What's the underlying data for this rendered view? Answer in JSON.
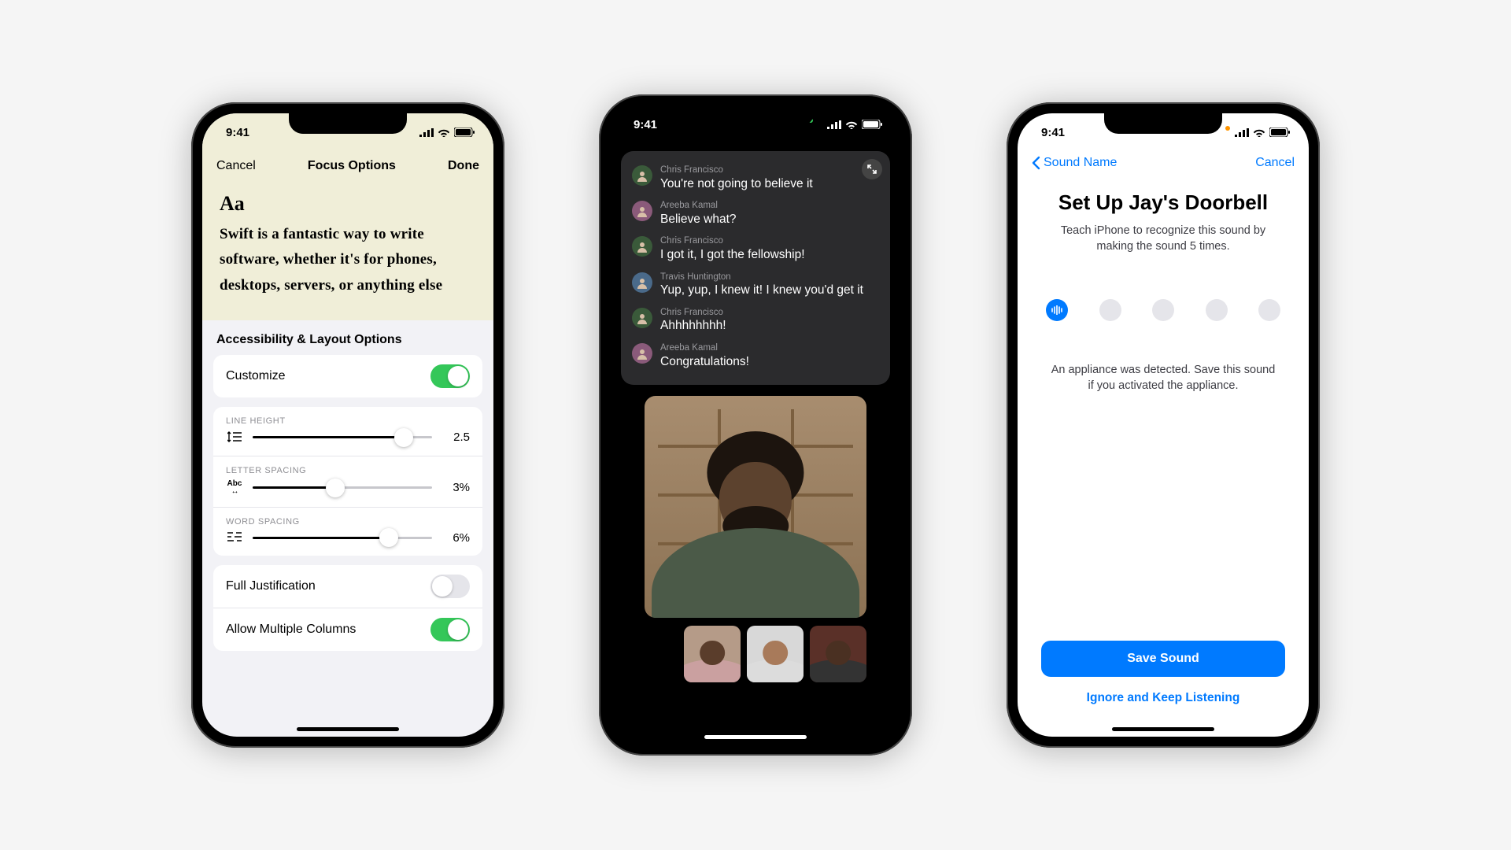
{
  "status": {
    "time": "9:41"
  },
  "phone1": {
    "nav": {
      "cancel": "Cancel",
      "title": "Focus Options",
      "done": "Done"
    },
    "reader": {
      "aa": "Aa",
      "passage": "Swift is a fantastic way to write software, whether it's for phones, desktops, servers, or anything else"
    },
    "section_title": "Accessibility & Layout Options",
    "customize_label": "Customize",
    "customize_on": true,
    "sliders": {
      "line_height": {
        "heading": "LINE HEIGHT",
        "value": "2.5",
        "pct": 84
      },
      "letter_spacing": {
        "heading": "LETTER SPACING",
        "value": "3%",
        "pct": 46
      },
      "word_spacing": {
        "heading": "WORD SPACING",
        "value": "6%",
        "pct": 76
      }
    },
    "full_justification_label": "Full Justification",
    "full_justification_on": false,
    "multi_columns_label": "Allow Multiple Columns",
    "multi_columns_on": true
  },
  "phone2": {
    "captions": [
      {
        "name": "Chris Francisco",
        "line": "You're not going to believe it",
        "avatar_bg": "#3a5a3a"
      },
      {
        "name": "Areeba Kamal",
        "line": "Believe what?",
        "avatar_bg": "#8a5a7a"
      },
      {
        "name": "Chris Francisco",
        "line": "I got it, I got the fellowship!",
        "avatar_bg": "#3a5a3a"
      },
      {
        "name": "Travis Huntington",
        "line": "Yup, yup, I knew it! I knew you'd get it",
        "avatar_bg": "#4a6a8a"
      },
      {
        "name": "Chris Francisco",
        "line": "Ahhhhhhhh!",
        "avatar_bg": "#3a5a3a"
      },
      {
        "name": "Areeba Kamal",
        "line": "Congratulations!",
        "avatar_bg": "#8a5a7a"
      }
    ],
    "thumbs": [
      {
        "bg": "#b59b88",
        "skin": "#5a3d2b",
        "shirt": "#caa0a0"
      },
      {
        "bg": "#d8d8d8",
        "skin": "#a87a5a",
        "shirt": "#dcdcdc"
      },
      {
        "bg": "#5a3028",
        "skin": "#4a3022",
        "shirt": "#333"
      }
    ]
  },
  "phone3": {
    "nav": {
      "back": "Sound Name",
      "cancel": "Cancel"
    },
    "title": "Set Up Jay's Doorbell",
    "subtitle": "Teach iPhone to recognize this sound by making the sound 5 times.",
    "progress": {
      "completed": 1,
      "total": 5
    },
    "detected_msg": "An appliance was detected. Save this sound if you activated the appliance.",
    "save_label": "Save Sound",
    "ignore_label": "Ignore and Keep Listening"
  }
}
